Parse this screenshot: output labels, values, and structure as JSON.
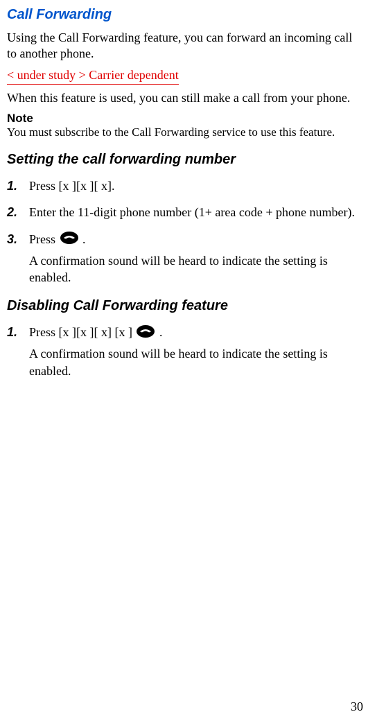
{
  "title": "Call Forwarding",
  "intro": "Using the Call Forwarding feature, you can forward an incoming call to another phone.",
  "redNote": "< under study > Carrier dependent",
  "intro2": "When this feature is used, you can still make a call from your phone.",
  "noteHeading": "Note",
  "noteBody_part1": "You must subscribe to ",
  "noteBody_part2": "the ",
  "noteBody_part3": "Call Forwarding service to use this feature.",
  "section1": {
    "heading": "Setting the call forwarding number",
    "steps": [
      {
        "num": "1.",
        "text": "Press [x ][x ][ x]."
      },
      {
        "num": "2.",
        "text": "Enter the 11-digit phone number (1+ area code + phone number)."
      },
      {
        "num": "3.",
        "text_before": "Press ",
        "text_after": " .",
        "follow": "A confirmation sound will be heard to indicate the setting is enabled."
      }
    ]
  },
  "section2": {
    "heading": "Disabling Call Forwarding feature",
    "steps": [
      {
        "num": "1.",
        "text_before": "Press [x ][x ][ x] [x ] ",
        "text_after": " .",
        "follow": "A confirmation sound will be heard to indicate the setting is enabled."
      }
    ]
  },
  "pageNumber": "30"
}
